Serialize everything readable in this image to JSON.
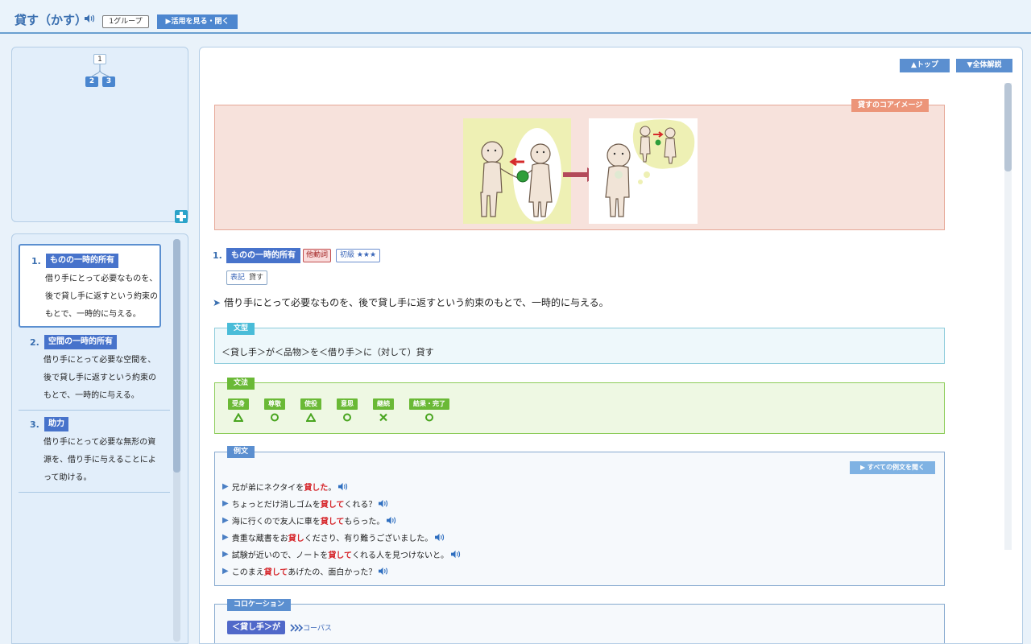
{
  "header": {
    "word": "貸す（かす）",
    "group": "1グループ",
    "conjugation_button": "▶活用を見る・閉く"
  },
  "tree": {
    "root": "1",
    "children": [
      "2",
      "3"
    ]
  },
  "sidebar": {
    "items": [
      {
        "num": "1.",
        "label": "ものの一時的所有",
        "desc": "借り手にとって必要なものを、後で貸し手に返すという約束のもとで、一時的に与える。"
      },
      {
        "num": "2.",
        "label": "空間の一時的所有",
        "desc": "借り手にとって必要な空間を、後で貸し手に返すという約束のもとで、一時的に与える。"
      },
      {
        "num": "3.",
        "label": "助力",
        "desc": "借り手にとって必要な無形の資源を、借り手に与えることによって助ける。"
      }
    ]
  },
  "nav": {
    "top": "▲トップ",
    "overview": "▼全体解説"
  },
  "core": {
    "tag": "貸すのコアイメージ"
  },
  "meaning": {
    "num": "1.",
    "label": "ものの一時的所有",
    "pos": "他動詞",
    "level": "初級 ★★★",
    "hyoki_key": "表記",
    "hyoki_val": "貸す",
    "definition_arrow": "➤",
    "definition": "借り手にとって必要なものを、後で貸し手に返すという約束のもとで、一時的に与える。"
  },
  "bunkei": {
    "title": "文型",
    "text": "＜貸し手＞が＜品物＞を＜借り手＞に（対して）貸す"
  },
  "bunpo": {
    "title": "文法",
    "items": [
      {
        "label": "受身",
        "mark": "triangle"
      },
      {
        "label": "尊敬",
        "mark": "circle"
      },
      {
        "label": "使役",
        "mark": "triangle"
      },
      {
        "label": "意思",
        "mark": "circle"
      },
      {
        "label": "継続",
        "mark": "cross"
      },
      {
        "label": "結果・完了",
        "mark": "circle"
      }
    ]
  },
  "reibun": {
    "title": "例文",
    "all_button": "▶ すべての例文を聞く",
    "examples": [
      {
        "before": "兄が弟にネクタイを",
        "hl": "貸した",
        "after": "。"
      },
      {
        "before": "ちょっとだけ消しゴムを",
        "hl": "貸して",
        "after": "くれる？"
      },
      {
        "before": "海に行くので友人に車を",
        "hl": "貸して",
        "after": "もらった。"
      },
      {
        "before": "貴重な蔵書をお",
        "hl": "貸し",
        "after": "くださり、有り難うございました。"
      },
      {
        "before": "試験が近いので、ノートを",
        "hl": "貸して",
        "after": "くれる人を見つけないと。"
      },
      {
        "before": "このまえ",
        "hl": "貸して",
        "after": "あげたの、面白かった？"
      }
    ]
  },
  "colloc": {
    "title": "コロケーション",
    "pill": "＜貸し手＞が",
    "corpus": "コーパス"
  },
  "colors": {
    "accent": "#4773cb",
    "highlight": "#d6262b",
    "bunpo_green": "#6ab936",
    "bunkei_cyan": "#49bcd8",
    "core_pink": "#ec9579"
  }
}
